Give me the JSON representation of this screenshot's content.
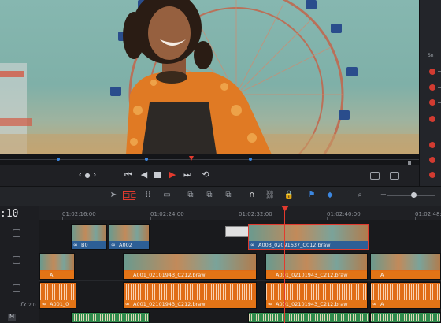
{
  "timeline": {
    "timecode": ":10",
    "ruler_ticks": [
      "01:02:16:00",
      "01:02:24:00",
      "01:02:32:00",
      "01:02:40:00",
      "01:02:48:00"
    ],
    "fx_label": "fx",
    "fx_value": "2.0",
    "m_label": "M",
    "clips": {
      "v2_a": "B0",
      "v2_b": "A002",
      "v2_c": "A003_02091637_C012.braw",
      "v1_a": "A",
      "v1_b": "A001_02101943_C212.braw",
      "v1_c": "A001_02101943_C212.braw",
      "v1_d": "A",
      "a1_a": "A001_0",
      "a1_b": "A001_02101943_C212.braw",
      "a1_c": "A001_02101943_C212.braw",
      "a1_d": "A"
    }
  },
  "sidebar": {
    "label": "Sn"
  },
  "colors": {
    "playhead": "#e33a2e",
    "video_clip": "#2d5f96",
    "audio_clip": "#e06c16",
    "marker": "#3c87e0"
  },
  "icons": [
    "chevron-left-icon",
    "chevron-right-icon",
    "skip-back-icon",
    "play-reverse-icon",
    "stop-icon",
    "play-icon",
    "skip-forward-icon",
    "loop-icon",
    "selection-tool-icon",
    "trim-tool-icon",
    "blade-tool-icon",
    "snap-icon",
    "link-icon",
    "lock-icon",
    "flag-icon",
    "marker-icon",
    "zoom-icon"
  ]
}
